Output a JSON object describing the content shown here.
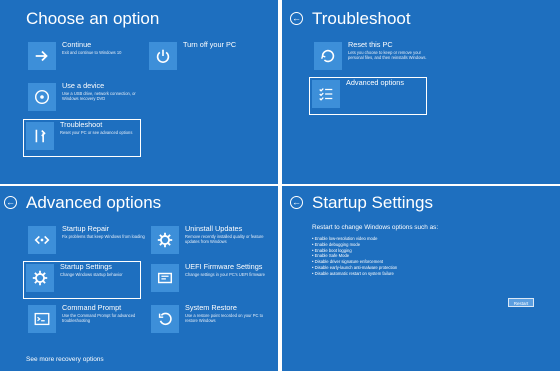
{
  "choose": {
    "title": "Choose an option",
    "continue": {
      "name": "Continue",
      "desc": "Exit and continue to Windows 10"
    },
    "turnoff": {
      "name": "Turn off your PC",
      "desc": ""
    },
    "device": {
      "name": "Use a device",
      "desc": "Use a USB drive, network connection, or Windows recovery DVD"
    },
    "troubleshoot": {
      "name": "Troubleshoot",
      "desc": "Reset your PC or see advanced options"
    }
  },
  "troubleshoot": {
    "title": "Troubleshoot",
    "reset": {
      "name": "Reset this PC",
      "desc": "Lets you choose to keep or remove your personal files, and then reinstalls Windows."
    },
    "advanced": {
      "name": "Advanced options",
      "desc": ""
    }
  },
  "advanced": {
    "title": "Advanced options",
    "repair": {
      "name": "Startup Repair",
      "desc": "Fix problems that keep Windows from loading"
    },
    "uninstall": {
      "name": "Uninstall Updates",
      "desc": "Remove recently installed quality or feature updates from Windows"
    },
    "settings": {
      "name": "Startup Settings",
      "desc": "Change Windows startup behavior"
    },
    "uefi": {
      "name": "UEFI Firmware Settings",
      "desc": "Change settings in your PC's UEFI firmware"
    },
    "cmd": {
      "name": "Command Prompt",
      "desc": "Use the Command Prompt for advanced troubleshooting"
    },
    "restore": {
      "name": "System Restore",
      "desc": "Use a restore point recorded on your PC to restore Windows"
    },
    "more": "See more recovery options"
  },
  "startup": {
    "title": "Startup Settings",
    "intro": "Restart to change Windows options such as:",
    "options": [
      "Enable low-resolution video mode",
      "Enable debugging mode",
      "Enable boot logging",
      "Enable Safe Mode",
      "Disable driver signature enforcement",
      "Disable early-launch anti-malware protection",
      "Disable automatic restart on system failure"
    ],
    "restart_label": "Restart"
  },
  "colors": {
    "background": "#1e6fbf",
    "tile_icon": "#3d8fd9",
    "text": "#ffffff"
  },
  "icons": [
    "arrow-right-icon",
    "power-icon",
    "disc-icon",
    "tools-icon",
    "reset-icon",
    "checklist-icon",
    "repair-icon",
    "gear-icon",
    "uefi-chip-icon",
    "cmd-icon",
    "restore-icon",
    "back-arrow-icon"
  ]
}
